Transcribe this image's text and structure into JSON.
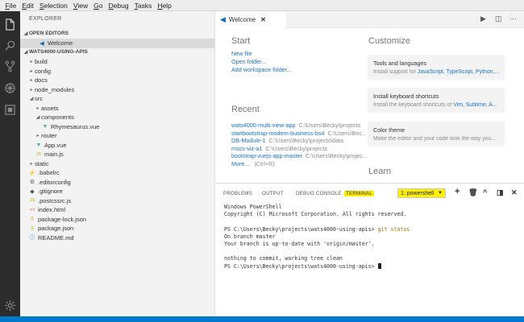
{
  "menu": [
    {
      "pre": "",
      "u": "F",
      "post": "ile"
    },
    {
      "pre": "",
      "u": "E",
      "post": "dit"
    },
    {
      "pre": "",
      "u": "S",
      "post": "election"
    },
    {
      "pre": "",
      "u": "V",
      "post": "iew"
    },
    {
      "pre": "",
      "u": "G",
      "post": "o"
    },
    {
      "pre": "",
      "u": "D",
      "post": "ebug"
    },
    {
      "pre": "",
      "u": "T",
      "post": "asks"
    },
    {
      "pre": "",
      "u": "H",
      "post": "elp"
    }
  ],
  "sidebar": {
    "title": "EXPLORER",
    "open_editors_label": "OPEN EDITORS",
    "open_editor_item": "Welcome",
    "project_label": "WATS4000-USING-APIS",
    "tree": [
      {
        "label": "build",
        "type": "folder",
        "expanded": false,
        "depth": 0
      },
      {
        "label": "config",
        "type": "folder",
        "expanded": false,
        "depth": 0
      },
      {
        "label": "docs",
        "type": "folder",
        "expanded": false,
        "depth": 0
      },
      {
        "label": "node_modules",
        "type": "folder",
        "expanded": false,
        "depth": 0
      },
      {
        "label": "src",
        "type": "folder",
        "expanded": true,
        "depth": 0
      },
      {
        "label": "assets",
        "type": "folder",
        "expanded": false,
        "depth": 1
      },
      {
        "label": "components",
        "type": "folder",
        "expanded": true,
        "depth": 1
      },
      {
        "label": "Rhymesaurus.vue",
        "type": "vue",
        "depth": 2
      },
      {
        "label": "router",
        "type": "folder",
        "expanded": false,
        "depth": 1
      },
      {
        "label": "App.vue",
        "type": "vue",
        "depth": 1
      },
      {
        "label": "main.js",
        "type": "js",
        "depth": 1
      },
      {
        "label": "static",
        "type": "folder",
        "expanded": false,
        "depth": 0
      },
      {
        "label": ".babelrc",
        "type": "babel",
        "depth": 0
      },
      {
        "label": ".editorconfig",
        "type": "config",
        "depth": 0
      },
      {
        "label": ".gitignore",
        "type": "git",
        "depth": 0
      },
      {
        "label": ".postcssrc.js",
        "type": "js",
        "depth": 0
      },
      {
        "label": "index.html",
        "type": "html",
        "depth": 0
      },
      {
        "label": "package-lock.json",
        "type": "json",
        "depth": 0
      },
      {
        "label": "package.json",
        "type": "json",
        "depth": 0
      },
      {
        "label": "README.md",
        "type": "md",
        "depth": 0
      }
    ]
  },
  "editor": {
    "tab_label": "Welcome",
    "start_heading": "Start",
    "start_links": [
      "New file",
      "Open folder...",
      "Add workspace folder..."
    ],
    "recent_heading": "Recent",
    "recent": [
      {
        "name": "wats4000-multi-view-app",
        "path": "C:\\Users\\Becky\\projects"
      },
      {
        "name": "startbootstrap-modern-business-bs4",
        "path": "C:\\Users\\Bec..."
      },
      {
        "name": "DB-Module-1",
        "path": "C:\\Users\\Becky\\projects\\data"
      },
      {
        "name": "mscs-viz-a1",
        "path": "C:\\Users\\Becky\\projects"
      },
      {
        "name": "bootstrap-vuejs-app-master",
        "path": "C:\\Users\\Becky\\projec..."
      }
    ],
    "more_label": "More...",
    "more_shortcut": "(Ctrl+R)",
    "customize_heading": "Customize",
    "cards": [
      {
        "title": "Tools and languages",
        "desc_pre": "Install support for ",
        "desc_hl": "JavaScript, TypeScript, Python,..."
      },
      {
        "title": "Install keyboard shortcuts",
        "desc_pre": "Install the keyboard shortcuts of ",
        "desc_hl": "Vim, Sublime, A..."
      },
      {
        "title": "Color theme",
        "desc_pre": "Make the editor and your code look the way you...",
        "desc_hl": ""
      }
    ],
    "learn_heading": "Learn"
  },
  "panel": {
    "tabs": [
      "PROBLEMS",
      "OUTPUT",
      "DEBUG CONSOLE",
      "TERMINAL"
    ],
    "active_tab": "TERMINAL",
    "shell_selected": "1: powershell",
    "terminal_lines": [
      {
        "text": "Windows PowerShell"
      },
      {
        "text": "Copyright (C) Microsoft Corporation. All rights reserved."
      },
      {
        "text": ""
      },
      {
        "text": "PS C:\\Users\\Becky\\projects\\wats4000-using-apis> ",
        "cmd": "git status"
      },
      {
        "text": "On branch master"
      },
      {
        "text": "Your branch is up-to-date with 'origin/master'."
      },
      {
        "text": ""
      },
      {
        "text": "nothing to commit, working tree clean"
      },
      {
        "text": "PS C:\\Users\\Becky\\projects\\wats4000-using-apis> ",
        "cursor": true
      }
    ]
  },
  "colors": {
    "activity_bar": "#2c2c2c",
    "accent": "#007acc",
    "link": "#1a73c7",
    "highlight": "#fff000"
  }
}
